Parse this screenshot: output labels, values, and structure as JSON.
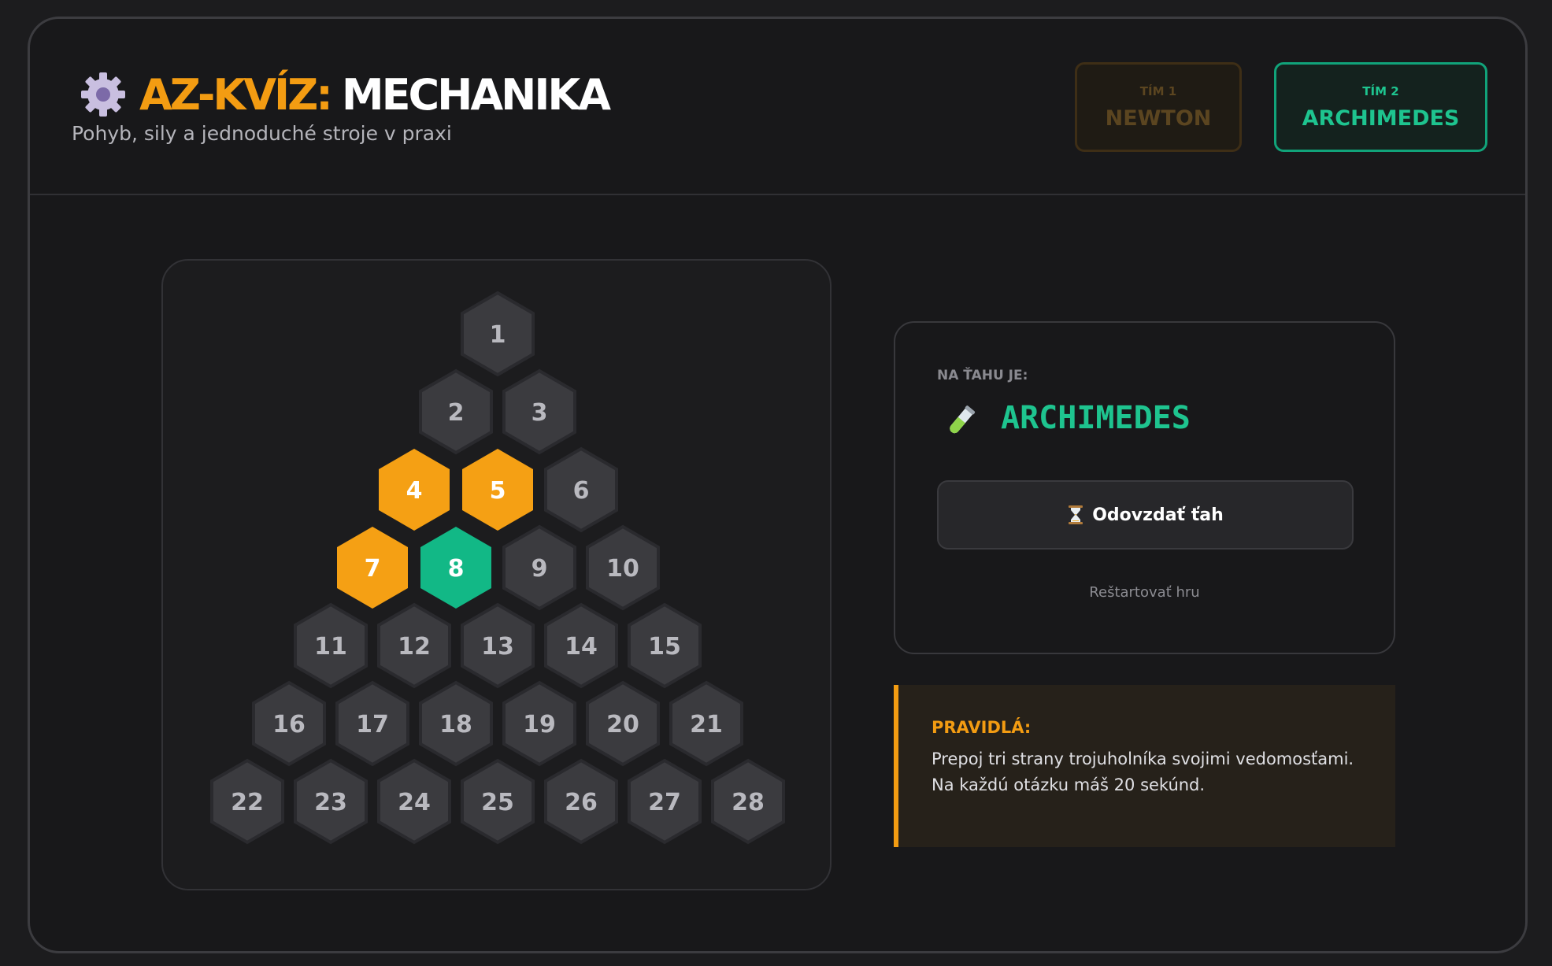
{
  "header": {
    "icon": "gear-icon",
    "title_accent": "AZ-KVÍZ:",
    "title_main": "MECHANIKA",
    "subtitle": "Pohyb, sily a jednoduché stroje v praxi"
  },
  "teams": [
    {
      "label": "TÍM 1",
      "name": "NEWTON",
      "color": "#f39c12",
      "active": false
    },
    {
      "label": "TÍM 2",
      "name": "ARCHIMEDES",
      "color": "#1ec48f",
      "active": true
    }
  ],
  "board": {
    "rows": [
      [
        "1"
      ],
      [
        "2",
        "3"
      ],
      [
        "4",
        "5",
        "6"
      ],
      [
        "7",
        "8",
        "9",
        "10"
      ],
      [
        "11",
        "12",
        "13",
        "14",
        "15"
      ],
      [
        "16",
        "17",
        "18",
        "19",
        "20",
        "21"
      ],
      [
        "22",
        "23",
        "24",
        "25",
        "26",
        "27",
        "28"
      ]
    ],
    "owners": {
      "4": "team1",
      "5": "team1",
      "7": "team1",
      "8": "team2"
    },
    "colors": {
      "team1": "#f5a014",
      "team2": "#12b886",
      "empty": "#3b3b3f",
      "empty_border": "#2a2a2e",
      "empty_text": "#b9b9bf",
      "owned_text": "#ffffff"
    }
  },
  "turn": {
    "label": "NA ŤAHU JE:",
    "icon": "test-tube-icon",
    "team": "ARCHIMEDES",
    "pass_icon": "hourglass-icon",
    "pass_label": "Odovzdať ťah",
    "restart_label": "Reštartovať hru"
  },
  "rules": {
    "title": "PRAVIDLÁ:",
    "lines": [
      "Prepoj tri strany trojuholníka svojimi vedomosťami.",
      "Na každú otázku máš 20 sekúnd."
    ]
  }
}
